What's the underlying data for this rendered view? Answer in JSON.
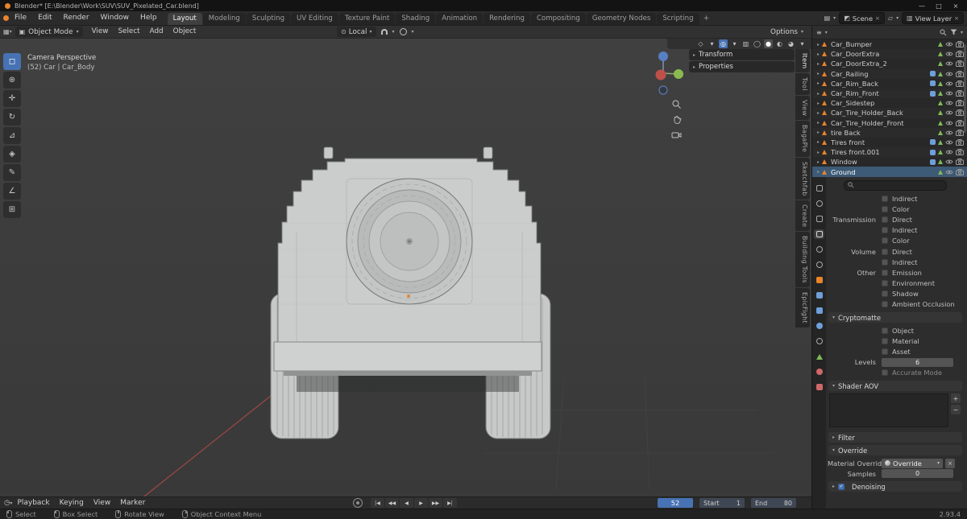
{
  "colors": {
    "accent_blue": "#4772b3",
    "object_orange": "#e8842c",
    "axis_red": "#c0504a",
    "axis_green": "#8aba50",
    "axis_blue": "#5680c2",
    "viewport_bg": "#3c3c3c",
    "car_gray": "#cacdcc"
  },
  "titlebar": {
    "title": "Blender* [E:\\Blender\\Work\\SUV\\SUV_Pixelated_Car.blend]",
    "minimize": "—",
    "maximize": "□",
    "close": "×"
  },
  "topbar": {
    "menus": [
      "File",
      "Edit",
      "Render",
      "Window",
      "Help"
    ],
    "workspaces": [
      "Layout",
      "Modeling",
      "Sculpting",
      "UV Editing",
      "Texture Paint",
      "Shading",
      "Animation",
      "Rendering",
      "Compositing",
      "Geometry Nodes",
      "Scripting"
    ],
    "active_workspace": "Layout",
    "add_workspace": "+",
    "scene_label": "Scene",
    "view_layer_label": "View Layer"
  },
  "viewport_header": {
    "mode": "Object Mode",
    "menus": [
      "View",
      "Select",
      "Add",
      "Object"
    ],
    "orientation": "Local",
    "options_label": "Options"
  },
  "toolbar": {
    "tools": [
      "select-box",
      "cursor",
      "move",
      "rotate",
      "scale",
      "transform",
      "annotate",
      "measure",
      "add-cube"
    ],
    "active": "select-box"
  },
  "viewport": {
    "overlay_line1": "Camera Perspective",
    "overlay_line2": "(52) Car | Car_Body"
  },
  "npanel": {
    "panels": [
      "Transform",
      "Properties"
    ],
    "tabs": [
      "Item",
      "Tool",
      "View",
      "BagaPie",
      "Sketchfab",
      "Create",
      "Building Tools",
      "EpicFight"
    ],
    "active_tab": "Item"
  },
  "outliner": {
    "items": [
      {
        "name": "Car_Bumper",
        "mods": false,
        "selected": false
      },
      {
        "name": "Car_DoorExtra",
        "mods": false,
        "selected": false
      },
      {
        "name": "Car_DoorExtra_2",
        "mods": false,
        "selected": false
      },
      {
        "name": "Car_Railing",
        "mods": true,
        "selected": false
      },
      {
        "name": "Car_Rim_Back",
        "mods": true,
        "selected": false
      },
      {
        "name": "Car_Rim_Front",
        "mods": true,
        "selected": false
      },
      {
        "name": "Car_Sidestep",
        "mods": false,
        "selected": false
      },
      {
        "name": "Car_Tire_Holder_Back",
        "mods": false,
        "selected": false
      },
      {
        "name": "Car_Tire_Holder_Front",
        "mods": false,
        "selected": false
      },
      {
        "name": "tire Back",
        "mods": false,
        "selected": false
      },
      {
        "name": "Tires front",
        "mods": true,
        "selected": false
      },
      {
        "name": "Tires front.001",
        "mods": true,
        "selected": false
      },
      {
        "name": "Window",
        "mods": true,
        "selected": false
      },
      {
        "name": "Ground",
        "mods": false,
        "selected": true
      }
    ]
  },
  "properties": {
    "tabs": [
      "tool",
      "render",
      "output",
      "view-layer",
      "scene",
      "world",
      "object",
      "modifiers",
      "particles",
      "physics",
      "constraints",
      "object-data",
      "material",
      "texture"
    ],
    "active_tab": "view-layer",
    "passes": [
      {
        "label": "",
        "option": "Indirect"
      },
      {
        "label": "",
        "option": "Color"
      },
      {
        "label": "Transmission",
        "option": "Direct"
      },
      {
        "label": "",
        "option": "Indirect"
      },
      {
        "label": "",
        "option": "Color"
      },
      {
        "label": "Volume",
        "option": "Direct"
      },
      {
        "label": "",
        "option": "Indirect"
      },
      {
        "label": "Other",
        "option": "Emission"
      },
      {
        "label": "",
        "option": "Environment"
      },
      {
        "label": "",
        "option": "Shadow"
      },
      {
        "label": "",
        "option": "Ambient Occlusion"
      }
    ],
    "cryptomatte": {
      "title": "Cryptomatte",
      "options": [
        "Object",
        "Material",
        "Asset"
      ],
      "levels_label": "Levels",
      "levels_value": "6",
      "accurate_label": "Accurate Mode"
    },
    "shader_aov": {
      "title": "Shader AOV"
    },
    "filter_title": "Filter",
    "override": {
      "title": "Override",
      "material_label": "Material Override",
      "material_value": "Override",
      "samples_label": "Samples",
      "samples_value": "0"
    },
    "denoising_label": "Denoising"
  },
  "timeline": {
    "menus": [
      "Playback",
      "Keying",
      "View",
      "Marker"
    ],
    "frame": "52",
    "start_label": "Start",
    "start_value": "1",
    "end_label": "End",
    "end_value": "80"
  },
  "statusbar": {
    "items": [
      {
        "icon": "mouse-left",
        "label": "Select"
      },
      {
        "icon": "mouse-left-drag",
        "label": "Box Select"
      },
      {
        "icon": "mouse-middle",
        "label": "Rotate View"
      },
      {
        "icon": "mouse-right",
        "label": "Object Context Menu"
      }
    ],
    "version": "2.93.4"
  }
}
